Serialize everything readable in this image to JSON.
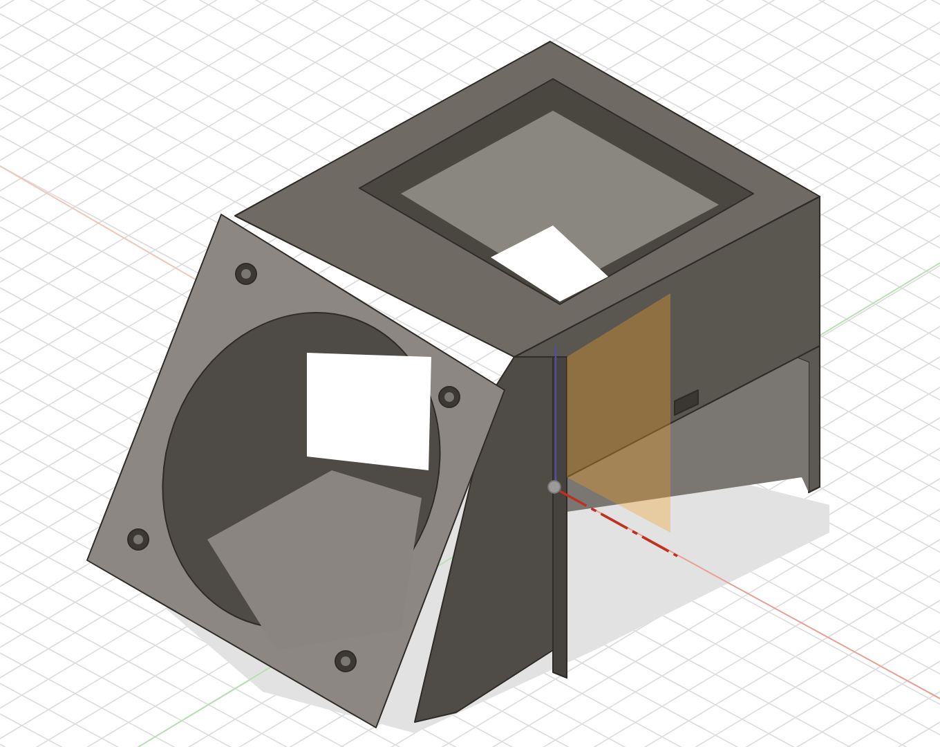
{
  "viewport": {
    "grid": true,
    "axes": true,
    "sketch_plane": true,
    "shadow": true
  }
}
